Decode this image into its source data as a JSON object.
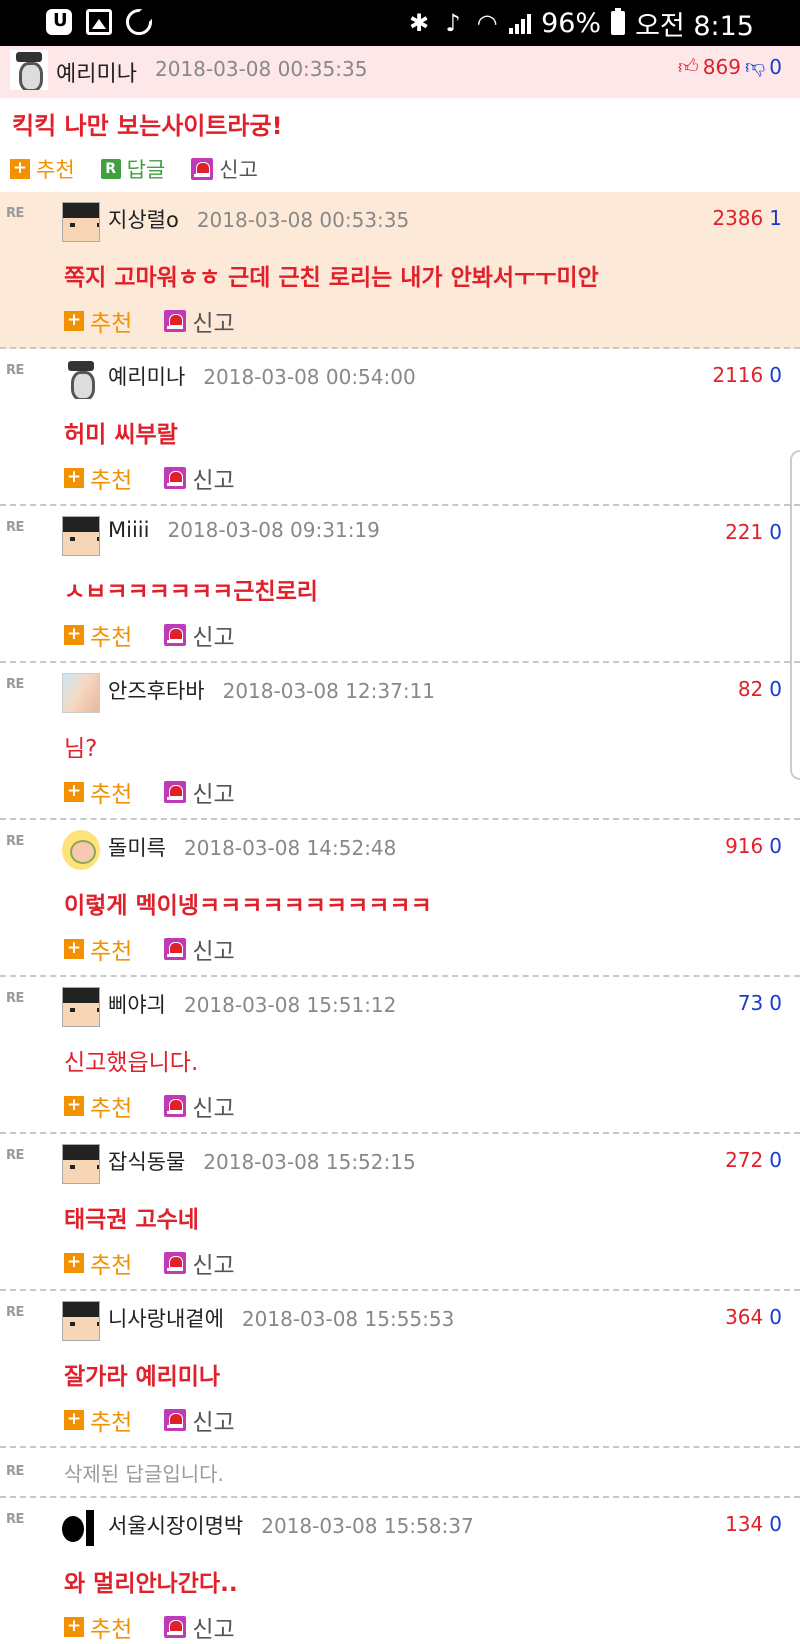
{
  "status_bar": {
    "battery": "96%",
    "time": "오전 8:15",
    "icons": [
      "app-icon",
      "gallery-icon",
      "moon-icon",
      "bluetooth-icon",
      "mute-icon",
      "wifi-icon",
      "signal-icon",
      "battery-icon"
    ]
  },
  "post": {
    "author": "예리미나",
    "date": "2018-03-08 00:35:35",
    "upvotes": "869",
    "downvotes": "0",
    "body": "킥킥 나만 보는사이트라궁!",
    "actions": {
      "recommend": "추천",
      "reply": "답글",
      "report": "신고"
    }
  },
  "actions": {
    "recommend": "추천",
    "report": "신고",
    "re_label": "RE"
  },
  "comments": [
    {
      "name": "지상렬o",
      "date": "2018-03-08 00:53:35",
      "up": "2386",
      "down": "1",
      "body": "쪽지 고마워ㅎㅎ 근데 근친 로리는 내가 안봐서ㅜㅜ미안",
      "avatar": "pixel-avatar"
    },
    {
      "name": "예리미나",
      "date": "2018-03-08 00:54:00",
      "up": "2116",
      "down": "0",
      "body": "허미 씨부랄",
      "avatar": "sketch-avatar"
    },
    {
      "name": "Miiii",
      "date": "2018-03-08 09:31:19",
      "up": "221",
      "down": "0",
      "body": "ㅅㅂㅋㅋㅋㅋㅋㅋ근친로리",
      "avatar": "pixel-avatar"
    },
    {
      "name": "안즈후타바",
      "date": "2018-03-08 12:37:11",
      "up": "82",
      "down": "0",
      "body": "님?",
      "avatar": "photo-avatar"
    },
    {
      "name": "돌미륵",
      "date": "2018-03-08 14:52:48",
      "up": "916",
      "down": "0",
      "body": "이렇게 멕이넹ㅋㅋㅋㅋㅋㅋㅋㅋㅋㅋㅋ",
      "avatar": "cartoon-avatar"
    },
    {
      "name": "삐야긔",
      "date": "2018-03-08 15:51:12",
      "up": "73",
      "down": "0",
      "body": "신고했읍니다.",
      "avatar": "pixel-avatar"
    },
    {
      "name": "잡식동물",
      "date": "2018-03-08 15:52:15",
      "up": "272",
      "down": "0",
      "body": "태극권 고수네",
      "avatar": "pixel-avatar"
    },
    {
      "name": "니사랑내곁에",
      "date": "2018-03-08 15:55:53",
      "up": "364",
      "down": "0",
      "body": "잘가라 예리미나",
      "avatar": "pixel-avatar"
    },
    {
      "name": "서울시장이명박",
      "date": "2018-03-08 15:58:37",
      "up": "134",
      "down": "0",
      "body": "와 멀리안나간다..",
      "avatar": "black-logo-avatar"
    }
  ],
  "deleted_notice": "삭제된 답글입니다.",
  "colors": {
    "accent_red": "#e0212b",
    "accent_blue": "#1a3cc8",
    "recommend_orange": "#f29200",
    "highlight_bg": "#fde9d8",
    "op_bg": "#fde7e8"
  }
}
